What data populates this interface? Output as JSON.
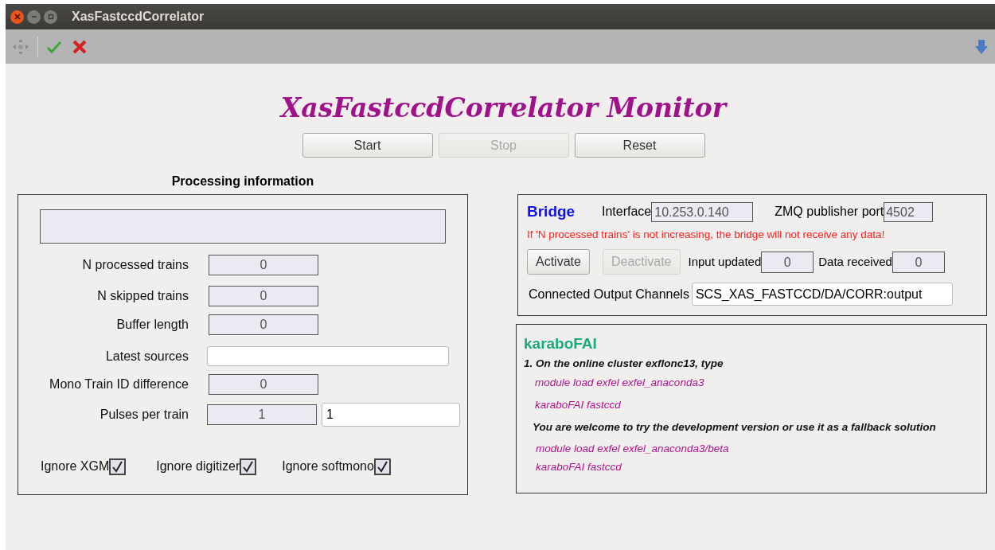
{
  "window": {
    "title": "XasFastccdCorrelator"
  },
  "monitor": {
    "title": "XasFastccdCorrelator Monitor",
    "buttons": [
      {
        "label": "Start",
        "disabled": false
      },
      {
        "label": "Stop",
        "disabled": true
      },
      {
        "label": "Reset",
        "disabled": false
      }
    ]
  },
  "processing": {
    "title": "Processing information",
    "rows": [
      {
        "label": "N processed trains",
        "kind": "readonly",
        "value": "0"
      },
      {
        "label": "N skipped trains",
        "kind": "readonly",
        "value": "0"
      },
      {
        "label": "Buffer length",
        "kind": "readonly",
        "value": "0"
      },
      {
        "label": "Latest sources",
        "kind": "wide_input"
      },
      {
        "label": "Mono Train ID difference",
        "kind": "readonly",
        "value": "0"
      },
      {
        "label": "Pulses per train",
        "kind": "readonly_input",
        "value": "1",
        "input": "1"
      }
    ],
    "checkboxes": [
      {
        "label": "Ignore XGM",
        "checked": true
      },
      {
        "label": "Ignore digitizer",
        "checked": true
      },
      {
        "label": "Ignore softmono",
        "checked": true
      }
    ]
  },
  "bridge": {
    "title": "Bridge",
    "interface_label": "Interface",
    "interface_value": "10.253.0.140",
    "port_label": "ZMQ publisher port",
    "port_value": "4502",
    "warning": "If 'N processed trains' is not increasing, the bridge will not receive any data!",
    "buttons": [
      {
        "label": "Activate",
        "disabled": false
      },
      {
        "label": "Deactivate",
        "disabled": true
      }
    ],
    "input_updated_label": "Input updated",
    "input_updated_value": "0",
    "data_received_label": "Data received",
    "data_received_value": "0",
    "channels_label": "Connected Output Channels",
    "channels_value": "SCS_XAS_FASTCCD/DA/CORR:output"
  },
  "karabofai": {
    "title": "karaboFAI",
    "lines": [
      {
        "kind": "instruction",
        "text": "1. On the online cluster exflonc13, type"
      },
      {
        "kind": "command",
        "text": "module load exfel exfel_anaconda3"
      },
      {
        "kind": "command",
        "text": "karaboFAI fastccd"
      },
      {
        "kind": "instruction",
        "text": "You are welcome to try the development version or use it as a fallback solution"
      },
      {
        "kind": "command",
        "text": "module load exfel exfel_anaconda3/beta"
      },
      {
        "kind": "command",
        "text": "karaboFAI fastccd"
      }
    ]
  }
}
